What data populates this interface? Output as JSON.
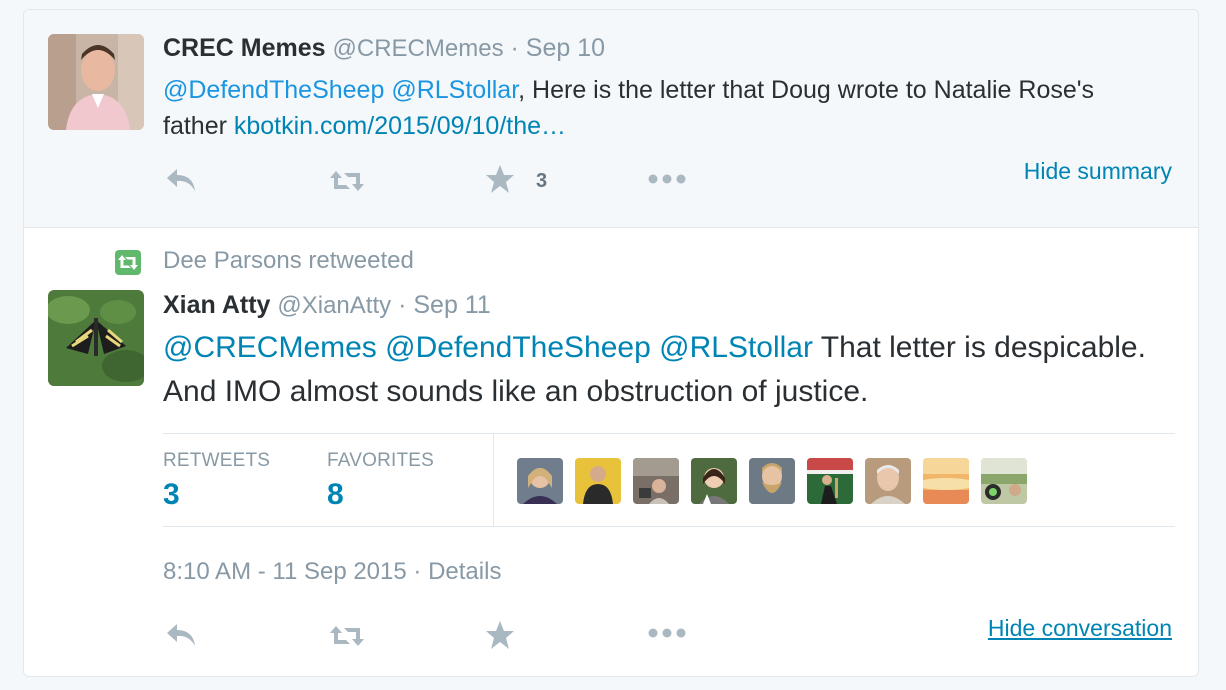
{
  "tweet1": {
    "fullname": "CREC Memes",
    "screenname": "@CRECMemes",
    "separator": "·",
    "time": "Sep 10",
    "text": {
      "mention1": "@DefendTheSheep",
      "mention2": "@RLStollar",
      "body1": ", Here is the letter that Doug wrote to Natalie Rose's father ",
      "link": "kbotkin.com/2015/09/10/the…"
    },
    "fav_count": "3",
    "hide_summary": "Hide summary"
  },
  "retweet_context": "Dee Parsons retweeted",
  "tweet2": {
    "fullname": "Xian Atty",
    "screenname": "@XianAtty",
    "separator": "·",
    "time": "Sep 11",
    "text": {
      "mention1": "@CRECMemes",
      "mention2": "@DefendTheSheep",
      "mention3": "@RLStollar",
      "body": " That letter is despicable. And IMO almost sounds like an obstruction of justice."
    },
    "stats": {
      "retweets_label": "RETWEETS",
      "retweets_value": "3",
      "favorites_label": "FAVORITES",
      "favorites_value": "8"
    },
    "meta": {
      "timestamp": "8:10 AM - 11 Sep 2015",
      "separator": "·",
      "details": "Details"
    },
    "hide_conversation": "Hide conversation"
  },
  "icons": {
    "reply": "reply-icon",
    "retweet": "retweet-icon",
    "favorite": "star-icon",
    "more": "more-dots-icon"
  },
  "colors": {
    "link": "#0084b4",
    "muted": "#8899a6",
    "icon": "#aab8c2",
    "retweet_green": "#5fb86b"
  }
}
